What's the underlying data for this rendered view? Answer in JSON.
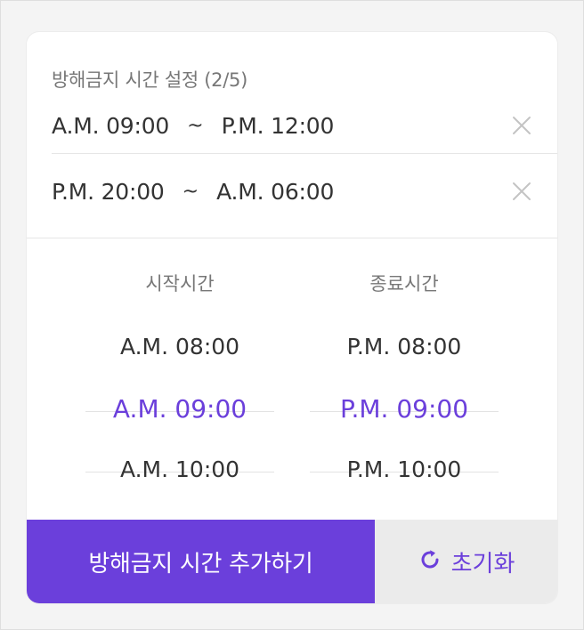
{
  "settings": {
    "title": "방해금지 시간 설정 (2/5)",
    "ranges": [
      {
        "start": "A.M. 09:00",
        "sep": "~",
        "end": "P.M. 12:00"
      },
      {
        "start": "P.M. 20:00",
        "sep": "~",
        "end": "A.M. 06:00"
      }
    ]
  },
  "picker": {
    "start": {
      "label": "시작시간",
      "prev": "A.M. 08:00",
      "selected": "A.M. 09:00",
      "next": "A.M. 10:00"
    },
    "end": {
      "label": "종료시간",
      "prev": "P.M. 08:00",
      "selected": "P.M. 09:00",
      "next": "P.M. 10:00"
    }
  },
  "actions": {
    "add_label": "방해금지 시간 추가하기",
    "reset_label": "초기화"
  },
  "colors": {
    "accent": "#6b3fdb",
    "text": "#333333",
    "muted": "#777777",
    "reset_bg": "#ebebeb"
  },
  "icons": {
    "delete": "close-icon",
    "reset": "refresh-icon"
  }
}
